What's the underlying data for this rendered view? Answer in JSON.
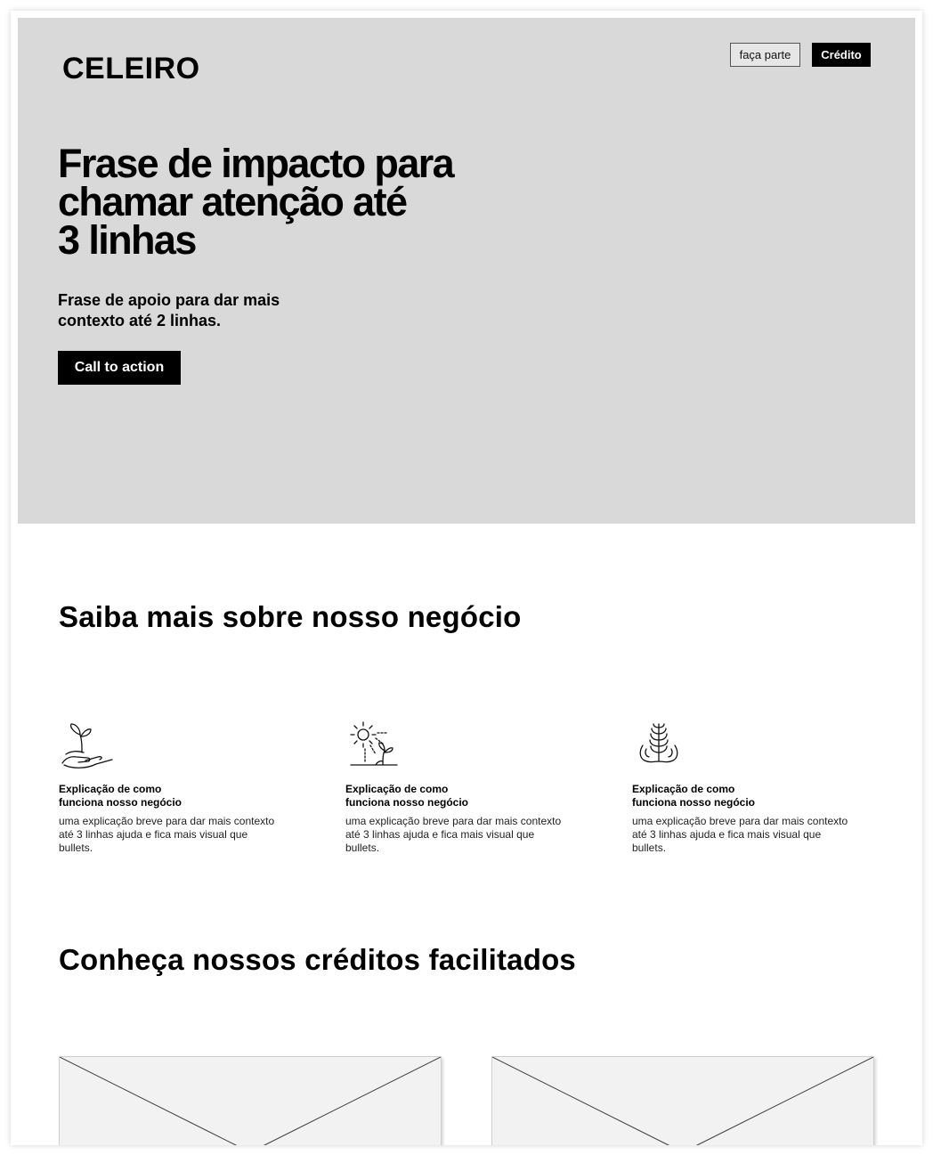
{
  "header": {
    "logo": "CELEIRO",
    "nav": {
      "join_label": "faça parte",
      "credit_label": "Crédito"
    }
  },
  "hero": {
    "title_lines": [
      "Frase de impacto para",
      "chamar atenção até",
      "3 linhas"
    ],
    "subtitle_lines": [
      "Frase de apoio para dar mais",
      "contexto até 2 linhas."
    ],
    "cta_label": "Call to action"
  },
  "about": {
    "title": "Saiba mais sobre nosso negócio",
    "features": [
      {
        "icon": "sprout-in-hand-icon",
        "title_lines": [
          "Explicação de como",
          "funciona nosso negócio"
        ],
        "desc_lines": [
          "uma explicação breve para dar mais contexto",
          "até 3 linhas ajuda  e fica mais visual que",
          "bullets."
        ]
      },
      {
        "icon": "sun-and-sprout-icon",
        "title_lines": [
          "Explicação de como",
          "funciona nosso negócio"
        ],
        "desc_lines": [
          "uma explicação breve para dar mais contexto",
          "até 3 linhas ajuda  e fica mais visual que",
          "bullets."
        ]
      },
      {
        "icon": "wheat-in-hands-icon",
        "title_lines": [
          "Explicação de como",
          "funciona nosso negócio"
        ],
        "desc_lines": [
          "uma explicação breve para dar mais contexto",
          "até 3 linhas ajuda  e fica mais visual que",
          "bullets."
        ]
      }
    ]
  },
  "credits": {
    "title": "Conheça nossos créditos facilitados",
    "cards": [
      {
        "image": "placeholder-image"
      },
      {
        "image": "placeholder-image"
      }
    ]
  },
  "colors": {
    "hero_bg": "#d9d9d9",
    "primary": "#000000",
    "on_primary": "#ffffff",
    "card_bg": "#f2f2f2"
  }
}
